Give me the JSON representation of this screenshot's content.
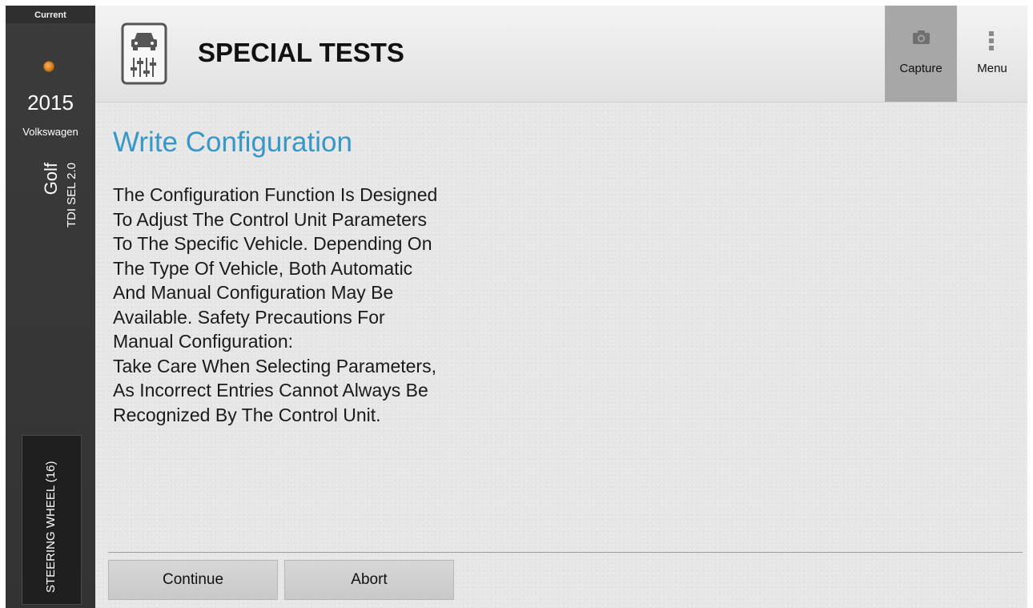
{
  "sidebar": {
    "current_label": "Current",
    "year": "2015",
    "make": "Volkswagen",
    "model": "Golf",
    "trim": "TDI SEL 2.0",
    "module": "STEERING WHEEL (16)"
  },
  "header": {
    "title": "SPECIAL TESTS",
    "capture_label": "Capture",
    "menu_label": "Menu"
  },
  "main": {
    "section_title": "Write Configuration",
    "description_lines": [
      "The Configuration Function Is Designed",
      "To Adjust The Control Unit Parameters",
      "To The Specific Vehicle. Depending On",
      "The Type Of Vehicle, Both Automatic",
      "And Manual Configuration May Be",
      "Available. Safety Precautions For",
      "Manual Configuration:",
      "Take Care When Selecting Parameters,",
      "As Incorrect Entries Cannot Always Be",
      "Recognized By The Control Unit."
    ],
    "continue_label": "Continue",
    "abort_label": "Abort"
  },
  "icons": {
    "app": "car-settings-icon",
    "capture": "camera-icon",
    "menu": "vertical-dots-icon",
    "status": "status-dot-icon"
  },
  "colors": {
    "accent": "#3797c9",
    "sidebar_bg": "#3a3a3a",
    "status_dot": "#e08a2c"
  }
}
